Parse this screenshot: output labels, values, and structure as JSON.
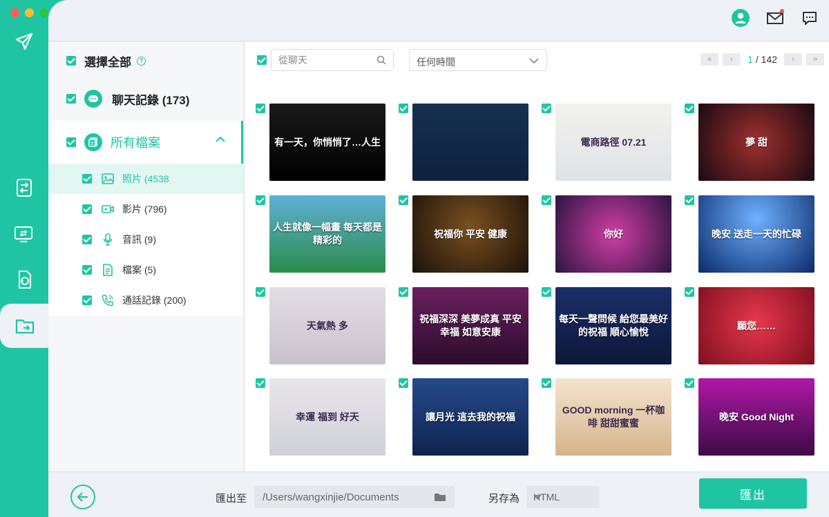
{
  "window": {
    "traffic_colors": [
      "#ff5f57",
      "#febc2e",
      "#28c840"
    ]
  },
  "rail": {
    "items": [
      {
        "icon": "transfer-icon"
      },
      {
        "icon": "device-sync-icon"
      },
      {
        "icon": "restore-icon"
      },
      {
        "icon": "export-folder-icon",
        "active": true
      }
    ]
  },
  "sidebar": {
    "select_all": "選擇全部",
    "chat_records": "聊天記錄 (173)",
    "all_files": "所有檔案",
    "sub": [
      {
        "label": "照片 (4538",
        "icon": "photo-icon"
      },
      {
        "label": "影片 (796)",
        "icon": "video-icon"
      },
      {
        "label": "音訊 (9)",
        "icon": "audio-icon"
      },
      {
        "label": "檔案 (5)",
        "icon": "document-icon"
      },
      {
        "label": "通話記錄 (200)",
        "icon": "call-icon"
      }
    ]
  },
  "filter": {
    "search_placeholder": "從聊天",
    "time_value": "任何時間",
    "pager": {
      "first": "«",
      "prev": "‹",
      "next": "›",
      "last": "»",
      "current": "1",
      "total": "/ 142"
    }
  },
  "grid": {
    "rows": [
      [
        {
          "text": "有一天，你悄悄了…人生",
          "bg": "linear-gradient(180deg,#1a1a1a,#000)"
        },
        {
          "text": "",
          "bg": "linear-gradient(180deg,#16304f,#0f2240)"
        },
        {
          "text": "電商路徑 07.21",
          "bg": "linear-gradient(180deg,#f2f1ec,#dfe3e8)",
          "dark": true
        },
        {
          "text": "夢 甜",
          "bg": "radial-gradient(circle at 50% 50%,#a0302e,#1a0a12)"
        }
      ],
      [
        {
          "text": "人生就像一幅畫 每天都是精彩的",
          "bg": "linear-gradient(180deg,#5fb0d9,#2c8c4a)"
        },
        {
          "text": "祝福你 平安 健康",
          "bg": "radial-gradient(circle at 50% 40%,#7a5020,#1b120a)"
        },
        {
          "text": "你好",
          "bg": "radial-gradient(circle at 50% 50%,#d13ea5,#2c1540)"
        },
        {
          "text": "晚安 送走一天的忙碌",
          "bg": "radial-gradient(circle at 50% 30%,#6fb1ff,#0a2a6a)"
        }
      ],
      [
        {
          "text": "天氣熱 多",
          "bg": "linear-gradient(180deg,#e4dde5,#c9c2ce)",
          "dark": true
        },
        {
          "text": "祝福深深 美夢成真 平安幸福 如意安康",
          "bg": "linear-gradient(180deg,#6a1f5e,#2b0c2e)"
        },
        {
          "text": "每天一聲問候 給您最美好的祝福 順心愉悅",
          "bg": "linear-gradient(180deg,#1a2e6a,#0d1738)"
        },
        {
          "text": "願您……",
          "bg": "radial-gradient(circle at 50% 45%,#e8374b,#7e0f20)"
        }
      ],
      [
        {
          "text": "幸運 福到 好天",
          "bg": "linear-gradient(180deg,#e9e6ea,#cfd0d8)",
          "dark": true
        },
        {
          "text": "讓月光 這去我的祝福",
          "bg": "linear-gradient(180deg,#244a8a,#0f2350)"
        },
        {
          "text": "GOOD morning 一杯咖啡 甜甜蜜蜜",
          "bg": "linear-gradient(180deg,#f2e4cf,#d6b48a)",
          "dark": true
        },
        {
          "text": "晚安 Good Night",
          "bg": "linear-gradient(180deg,#b018a8,#3c0a45)"
        }
      ]
    ]
  },
  "bottom": {
    "export_to_label": "匯出至",
    "path": "/Users/wangxinjie/Documents",
    "save_as_label": "另存為",
    "format": "HTML",
    "export_button": "匯出"
  }
}
